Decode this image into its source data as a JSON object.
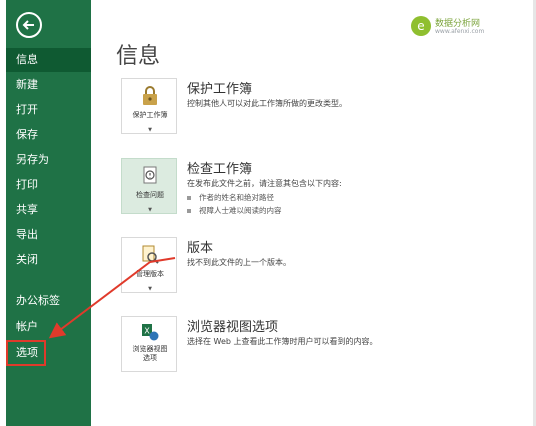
{
  "sidebar": {
    "items": [
      {
        "label": "信息",
        "active": true
      },
      {
        "label": "新建"
      },
      {
        "label": "打开"
      },
      {
        "label": "保存"
      },
      {
        "label": "另存为"
      },
      {
        "label": "打印"
      },
      {
        "label": "共享"
      },
      {
        "label": "导出"
      },
      {
        "label": "关闭"
      },
      {
        "label": "办公标签"
      },
      {
        "label": "帐户"
      },
      {
        "label": "选项"
      }
    ]
  },
  "main": {
    "title": "信息",
    "brand": {
      "name": "数据分析网",
      "url": "www.afenxi.com",
      "logo_letter": "e"
    },
    "sections": [
      {
        "button_label": "保护工作簿",
        "title": "保护工作簿",
        "desc": "控制其他人可以对此工作簿所做的更改类型。"
      },
      {
        "button_label": "检查问题",
        "title": "检查工作簿",
        "desc": "在发布此文件之前，请注意其包含以下内容:",
        "bullets": [
          "作者的姓名和绝对路径",
          "视障人士难以阅读的内容"
        ]
      },
      {
        "button_label": "管理版本",
        "title": "版本",
        "desc": "找不到此文件的上一个版本。"
      },
      {
        "button_label_line1": "浏览器视图",
        "button_label_line2": "选项",
        "title": "浏览器视图选项",
        "desc": "选择在 Web 上查看此工作簿时用户可以看到的内容。"
      }
    ]
  },
  "colors": {
    "sidebar": "#1f7246",
    "sidebar_active": "#0f5a32",
    "highlight": "#e03a2b",
    "selected_card": "#dcebe0"
  }
}
